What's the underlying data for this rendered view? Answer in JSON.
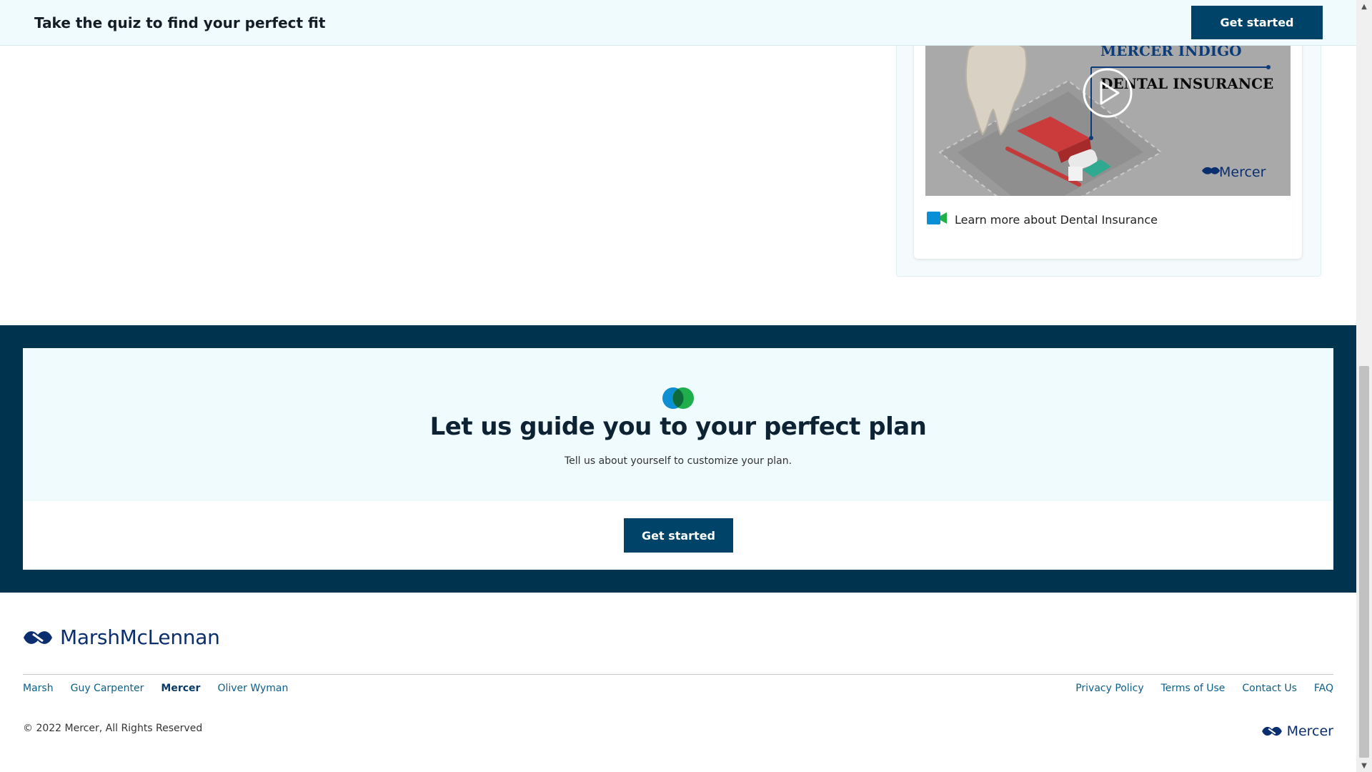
{
  "topbar": {
    "title": "Take the quiz to find your perfect fit",
    "button_label": "Get started"
  },
  "video": {
    "thumbnail_heading_1": "MERCER INDIGO",
    "thumbnail_heading_2": "DENTAL INSURANCE",
    "thumbnail_brand": "Mercer",
    "link_label": "Learn more about Dental Insurance",
    "icon": "video-camera-icon"
  },
  "guide": {
    "title": "Let us guide you to your perfect plan",
    "subtitle": "Tell us about yourself to customize your plan.",
    "button_label": "Get started"
  },
  "footer": {
    "brand": "MarshMcLennan",
    "companies": [
      {
        "label": "Marsh"
      },
      {
        "label": "Guy Carpenter"
      },
      {
        "label": "Mercer"
      },
      {
        "label": "Oliver Wyman"
      }
    ],
    "legal_links": [
      {
        "label": "Privacy Policy"
      },
      {
        "label": "Terms of Use"
      },
      {
        "label": "Contact Us"
      },
      {
        "label": "FAQ"
      }
    ],
    "copyright": "© 2022 Mercer, All Rights Reserved",
    "mercer_brand": "Mercer"
  },
  "colors": {
    "primary": "#004368",
    "band": "#00334d",
    "light_bg": "#effbfc",
    "brand_blue": "#0a2e6e"
  }
}
